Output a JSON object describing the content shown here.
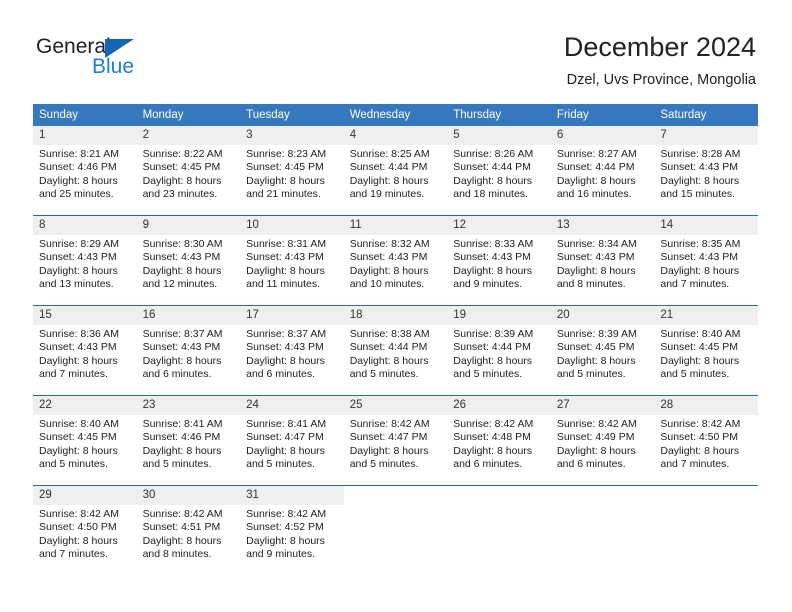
{
  "logo": {
    "line1": "General",
    "line2": "Blue",
    "triangle_color": "#1567b3",
    "blue_text_color": "#1f7fd0"
  },
  "header": {
    "title": "December 2024",
    "subtitle": "Dzel, Uvs Province, Mongolia"
  },
  "colors": {
    "header_blue": "#3578bd",
    "row_divider": "#2b6aa8",
    "daynum_band": "#efefef"
  },
  "weekday_headers": [
    "Sunday",
    "Monday",
    "Tuesday",
    "Wednesday",
    "Thursday",
    "Friday",
    "Saturday"
  ],
  "weeks": [
    [
      {
        "day": "1",
        "sunrise": "Sunrise: 8:21 AM",
        "sunset": "Sunset: 4:46 PM",
        "daylight1": "Daylight: 8 hours",
        "daylight2": "and 25 minutes."
      },
      {
        "day": "2",
        "sunrise": "Sunrise: 8:22 AM",
        "sunset": "Sunset: 4:45 PM",
        "daylight1": "Daylight: 8 hours",
        "daylight2": "and 23 minutes."
      },
      {
        "day": "3",
        "sunrise": "Sunrise: 8:23 AM",
        "sunset": "Sunset: 4:45 PM",
        "daylight1": "Daylight: 8 hours",
        "daylight2": "and 21 minutes."
      },
      {
        "day": "4",
        "sunrise": "Sunrise: 8:25 AM",
        "sunset": "Sunset: 4:44 PM",
        "daylight1": "Daylight: 8 hours",
        "daylight2": "and 19 minutes."
      },
      {
        "day": "5",
        "sunrise": "Sunrise: 8:26 AM",
        "sunset": "Sunset: 4:44 PM",
        "daylight1": "Daylight: 8 hours",
        "daylight2": "and 18 minutes."
      },
      {
        "day": "6",
        "sunrise": "Sunrise: 8:27 AM",
        "sunset": "Sunset: 4:44 PM",
        "daylight1": "Daylight: 8 hours",
        "daylight2": "and 16 minutes."
      },
      {
        "day": "7",
        "sunrise": "Sunrise: 8:28 AM",
        "sunset": "Sunset: 4:43 PM",
        "daylight1": "Daylight: 8 hours",
        "daylight2": "and 15 minutes."
      }
    ],
    [
      {
        "day": "8",
        "sunrise": "Sunrise: 8:29 AM",
        "sunset": "Sunset: 4:43 PM",
        "daylight1": "Daylight: 8 hours",
        "daylight2": "and 13 minutes."
      },
      {
        "day": "9",
        "sunrise": "Sunrise: 8:30 AM",
        "sunset": "Sunset: 4:43 PM",
        "daylight1": "Daylight: 8 hours",
        "daylight2": "and 12 minutes."
      },
      {
        "day": "10",
        "sunrise": "Sunrise: 8:31 AM",
        "sunset": "Sunset: 4:43 PM",
        "daylight1": "Daylight: 8 hours",
        "daylight2": "and 11 minutes."
      },
      {
        "day": "11",
        "sunrise": "Sunrise: 8:32 AM",
        "sunset": "Sunset: 4:43 PM",
        "daylight1": "Daylight: 8 hours",
        "daylight2": "and 10 minutes."
      },
      {
        "day": "12",
        "sunrise": "Sunrise: 8:33 AM",
        "sunset": "Sunset: 4:43 PM",
        "daylight1": "Daylight: 8 hours",
        "daylight2": "and 9 minutes."
      },
      {
        "day": "13",
        "sunrise": "Sunrise: 8:34 AM",
        "sunset": "Sunset: 4:43 PM",
        "daylight1": "Daylight: 8 hours",
        "daylight2": "and 8 minutes."
      },
      {
        "day": "14",
        "sunrise": "Sunrise: 8:35 AM",
        "sunset": "Sunset: 4:43 PM",
        "daylight1": "Daylight: 8 hours",
        "daylight2": "and 7 minutes."
      }
    ],
    [
      {
        "day": "15",
        "sunrise": "Sunrise: 8:36 AM",
        "sunset": "Sunset: 4:43 PM",
        "daylight1": "Daylight: 8 hours",
        "daylight2": "and 7 minutes."
      },
      {
        "day": "16",
        "sunrise": "Sunrise: 8:37 AM",
        "sunset": "Sunset: 4:43 PM",
        "daylight1": "Daylight: 8 hours",
        "daylight2": "and 6 minutes."
      },
      {
        "day": "17",
        "sunrise": "Sunrise: 8:37 AM",
        "sunset": "Sunset: 4:43 PM",
        "daylight1": "Daylight: 8 hours",
        "daylight2": "and 6 minutes."
      },
      {
        "day": "18",
        "sunrise": "Sunrise: 8:38 AM",
        "sunset": "Sunset: 4:44 PM",
        "daylight1": "Daylight: 8 hours",
        "daylight2": "and 5 minutes."
      },
      {
        "day": "19",
        "sunrise": "Sunrise: 8:39 AM",
        "sunset": "Sunset: 4:44 PM",
        "daylight1": "Daylight: 8 hours",
        "daylight2": "and 5 minutes."
      },
      {
        "day": "20",
        "sunrise": "Sunrise: 8:39 AM",
        "sunset": "Sunset: 4:45 PM",
        "daylight1": "Daylight: 8 hours",
        "daylight2": "and 5 minutes."
      },
      {
        "day": "21",
        "sunrise": "Sunrise: 8:40 AM",
        "sunset": "Sunset: 4:45 PM",
        "daylight1": "Daylight: 8 hours",
        "daylight2": "and 5 minutes."
      }
    ],
    [
      {
        "day": "22",
        "sunrise": "Sunrise: 8:40 AM",
        "sunset": "Sunset: 4:45 PM",
        "daylight1": "Daylight: 8 hours",
        "daylight2": "and 5 minutes."
      },
      {
        "day": "23",
        "sunrise": "Sunrise: 8:41 AM",
        "sunset": "Sunset: 4:46 PM",
        "daylight1": "Daylight: 8 hours",
        "daylight2": "and 5 minutes."
      },
      {
        "day": "24",
        "sunrise": "Sunrise: 8:41 AM",
        "sunset": "Sunset: 4:47 PM",
        "daylight1": "Daylight: 8 hours",
        "daylight2": "and 5 minutes."
      },
      {
        "day": "25",
        "sunrise": "Sunrise: 8:42 AM",
        "sunset": "Sunset: 4:47 PM",
        "daylight1": "Daylight: 8 hours",
        "daylight2": "and 5 minutes."
      },
      {
        "day": "26",
        "sunrise": "Sunrise: 8:42 AM",
        "sunset": "Sunset: 4:48 PM",
        "daylight1": "Daylight: 8 hours",
        "daylight2": "and 6 minutes."
      },
      {
        "day": "27",
        "sunrise": "Sunrise: 8:42 AM",
        "sunset": "Sunset: 4:49 PM",
        "daylight1": "Daylight: 8 hours",
        "daylight2": "and 6 minutes."
      },
      {
        "day": "28",
        "sunrise": "Sunrise: 8:42 AM",
        "sunset": "Sunset: 4:50 PM",
        "daylight1": "Daylight: 8 hours",
        "daylight2": "and 7 minutes."
      }
    ],
    [
      {
        "day": "29",
        "sunrise": "Sunrise: 8:42 AM",
        "sunset": "Sunset: 4:50 PM",
        "daylight1": "Daylight: 8 hours",
        "daylight2": "and 7 minutes."
      },
      {
        "day": "30",
        "sunrise": "Sunrise: 8:42 AM",
        "sunset": "Sunset: 4:51 PM",
        "daylight1": "Daylight: 8 hours",
        "daylight2": "and 8 minutes."
      },
      {
        "day": "31",
        "sunrise": "Sunrise: 8:42 AM",
        "sunset": "Sunset: 4:52 PM",
        "daylight1": "Daylight: 8 hours",
        "daylight2": "and 9 minutes."
      },
      {
        "day": "",
        "sunrise": "",
        "sunset": "",
        "daylight1": "",
        "daylight2": ""
      },
      {
        "day": "",
        "sunrise": "",
        "sunset": "",
        "daylight1": "",
        "daylight2": ""
      },
      {
        "day": "",
        "sunrise": "",
        "sunset": "",
        "daylight1": "",
        "daylight2": ""
      },
      {
        "day": "",
        "sunrise": "",
        "sunset": "",
        "daylight1": "",
        "daylight2": ""
      }
    ]
  ]
}
